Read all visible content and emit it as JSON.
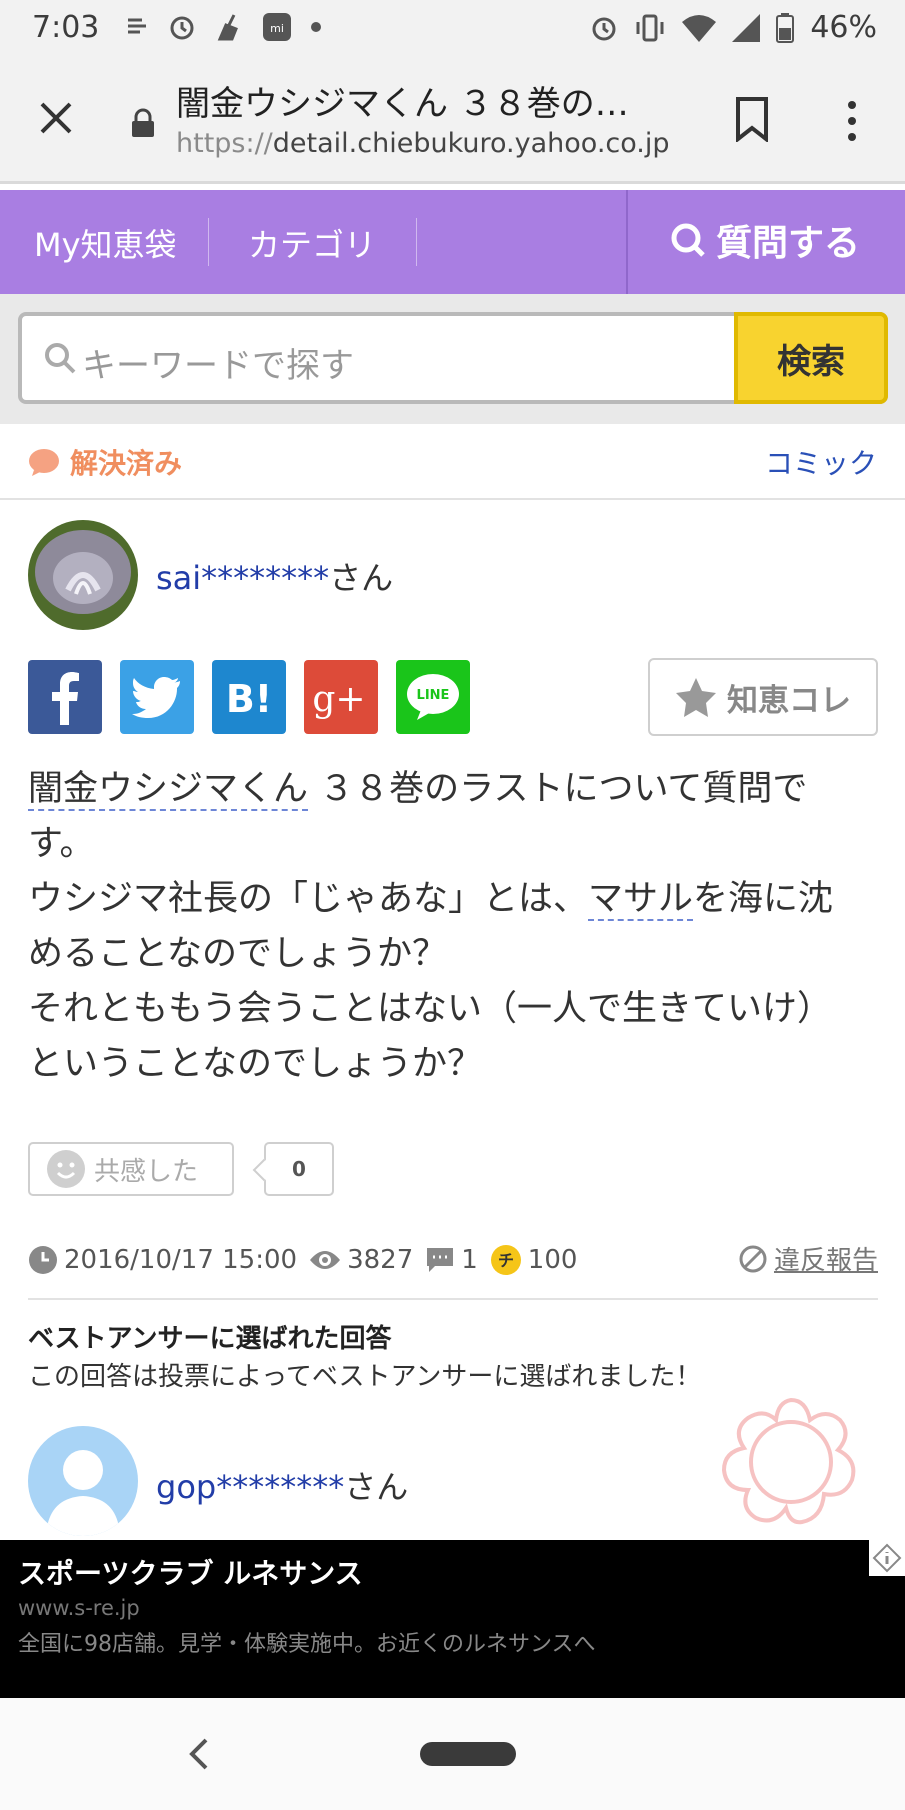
{
  "status_bar": {
    "time": "7:03",
    "battery": "46%",
    "notification_icons": [
      "weather-icon",
      "alarm-icon",
      "broom-icon",
      "mi-icon",
      "dot-icon"
    ],
    "system_icons": [
      "alarm-icon",
      "vibrate-icon",
      "wifi-icon",
      "signal-icon",
      "battery-icon"
    ]
  },
  "browser": {
    "tab_title": "闇金ウシジマくん ３８巻の…",
    "url_scheme": "https://",
    "url_host": "detail.chiebukuro.yahoo.co.jp"
  },
  "nav": {
    "my": "My知恵袋",
    "category": "カテゴリ",
    "ask": "質問する"
  },
  "search": {
    "placeholder": "キーワードで探す",
    "button": "検索"
  },
  "status": {
    "resolved": "解決済み",
    "category": "コミック"
  },
  "question": {
    "user_id": "sai********",
    "user_suffix": "さん",
    "chie_button": "知恵コレ",
    "lines": {
      "l1_ul": "闇金ウシジマくん",
      "l1_rest": " ３８巻のラストについて質問で",
      "l2": "す。",
      "l3_a": "ウシジマ社長の「じゃあな」とは、",
      "l3_ul": "マサル",
      "l3_b": "を海に沈",
      "l4": "めることなのでしょうか？",
      "l5": "それとももう会うことはない（一人で生きていけ）",
      "l6": "ということなのでしょうか？"
    },
    "empathy_label": "共感した",
    "empathy_count": "0",
    "date": "2016/10/17 15:00",
    "views": "3827",
    "answers": "1",
    "coins": "100",
    "coin_glyph": "チ",
    "report": "違反報告"
  },
  "best_answer": {
    "heading": "ベストアンサーに選ばれた回答",
    "description": "この回答は投票によってベストアンサーに選ばれました！",
    "user_id": "gop********",
    "user_suffix": "さん"
  },
  "ad": {
    "title": "スポーツクラブ ルネサンス",
    "url": "www.s-re.jp",
    "description": "全国に98店舗。見学・体験実施中。お近くのルネサンスへ"
  },
  "colors": {
    "nav_purple": "#a97ee2",
    "search_button": "#f8d32f",
    "resolved_orange": "#f08e5f",
    "link_blue": "#223da8"
  }
}
